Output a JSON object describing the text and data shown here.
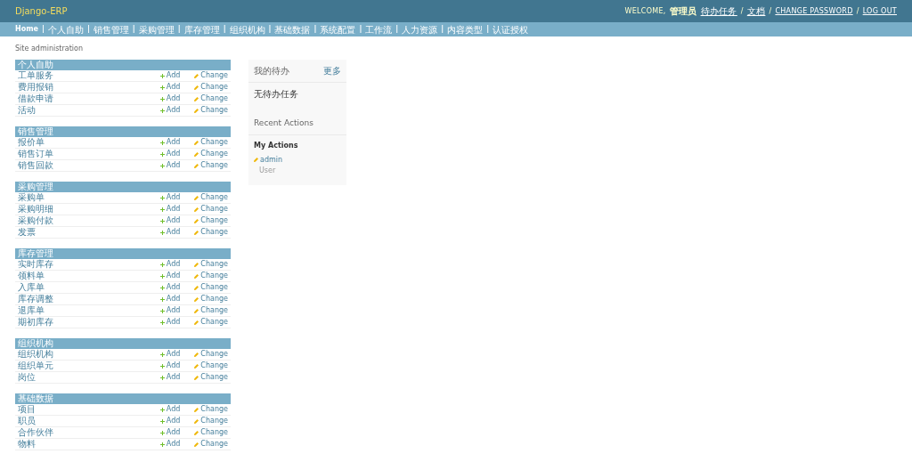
{
  "header": {
    "brand": "Django-ERP",
    "welcome": "WELCOME,",
    "user": "管理员",
    "separator": "/",
    "links": [
      "待办任务",
      "文档",
      "CHANGE PASSWORD",
      "LOG OUT"
    ]
  },
  "breadcrumbs": {
    "separator": "|",
    "items": [
      "Home",
      "个人自助",
      "销售管理",
      "采购管理",
      "库存管理",
      "组织机构",
      "基础数据",
      "系统配置",
      "工作流",
      "人力资源",
      "内容类型",
      "认证授权"
    ]
  },
  "title": "Site administration",
  "modules": [
    {
      "caption": "个人自助",
      "models": [
        {
          "name": "工单服务",
          "add": "Add",
          "change": "Change"
        },
        {
          "name": "费用报销",
          "add": "Add",
          "change": "Change"
        },
        {
          "name": "借款申请",
          "add": "Add",
          "change": "Change"
        },
        {
          "name": "活动",
          "add": "Add",
          "change": "Change"
        }
      ]
    },
    {
      "caption": "销售管理",
      "models": [
        {
          "name": "报价单",
          "add": "Add",
          "change": "Change"
        },
        {
          "name": "销售订单",
          "add": "Add",
          "change": "Change"
        },
        {
          "name": "销售回款",
          "add": "Add",
          "change": "Change"
        }
      ]
    },
    {
      "caption": "采购管理",
      "models": [
        {
          "name": "采购单",
          "add": "Add",
          "change": "Change"
        },
        {
          "name": "采购明细",
          "add": "Add",
          "change": "Change"
        },
        {
          "name": "采购付款",
          "add": "Add",
          "change": "Change"
        },
        {
          "name": "发票",
          "add": "Add",
          "change": "Change"
        }
      ]
    },
    {
      "caption": "库存管理",
      "models": [
        {
          "name": "实时库存",
          "add": "Add",
          "change": "Change"
        },
        {
          "name": "领料单",
          "add": "Add",
          "change": "Change"
        },
        {
          "name": "入库单",
          "add": "Add",
          "change": "Change"
        },
        {
          "name": "库存调整",
          "add": "Add",
          "change": "Change"
        },
        {
          "name": "退库单",
          "add": "Add",
          "change": "Change"
        },
        {
          "name": "期初库存",
          "add": "Add",
          "change": "Change"
        }
      ]
    },
    {
      "caption": "组织机构",
      "models": [
        {
          "name": "组织机构",
          "add": "Add",
          "change": "Change"
        },
        {
          "name": "组织单元",
          "add": "Add",
          "change": "Change"
        },
        {
          "name": "岗位",
          "add": "Add",
          "change": "Change"
        }
      ]
    },
    {
      "caption": "基础数据",
      "models": [
        {
          "name": "项目",
          "add": "Add",
          "change": "Change"
        },
        {
          "name": "职员",
          "add": "Add",
          "change": "Change"
        },
        {
          "name": "合作伙伴",
          "add": "Add",
          "change": "Change"
        },
        {
          "name": "物料",
          "add": "Add",
          "change": "Change"
        }
      ]
    }
  ],
  "todo": {
    "title": "我的待办",
    "more": "更多",
    "empty": "无待办任务"
  },
  "recent": {
    "title": "Recent Actions",
    "subtitle": "My Actions",
    "items": [
      {
        "name": "admin",
        "type": "User"
      }
    ]
  }
}
